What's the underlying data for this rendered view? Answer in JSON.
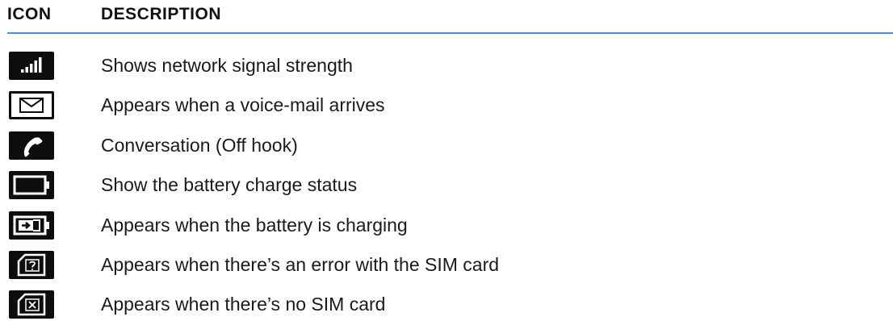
{
  "header": {
    "icon_label": "ICON",
    "description_label": "DESCRIPTION"
  },
  "colors": {
    "rule": "#4a8fd6",
    "icon_background": "#0d0d0d",
    "icon_foreground": "#ffffff",
    "text": "#1a1a1a"
  },
  "rows": [
    {
      "icon": "signal-strength-icon",
      "description": "Shows network signal strength"
    },
    {
      "icon": "envelope-icon",
      "description": "Appears when a voice-mail arrives"
    },
    {
      "icon": "phone-handset-icon",
      "description": "Conversation (Off hook)"
    },
    {
      "icon": "battery-icon",
      "description": "Show the battery charge status"
    },
    {
      "icon": "battery-charging-icon",
      "description": "Appears when the battery is charging"
    },
    {
      "icon": "sim-error-icon",
      "description": "Appears when there’s an error with the SIM card"
    },
    {
      "icon": "no-sim-icon",
      "description": "Appears when there’s no SIM card"
    }
  ]
}
